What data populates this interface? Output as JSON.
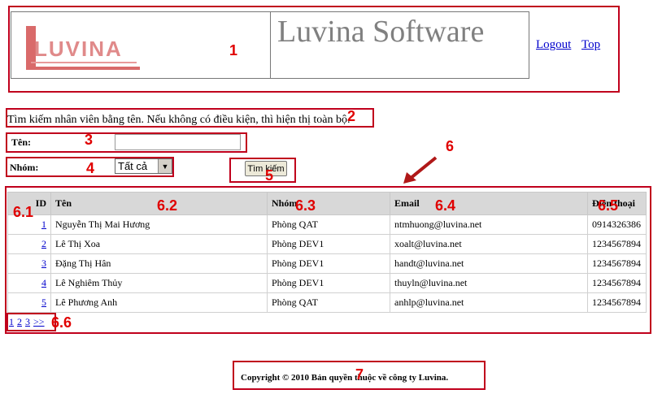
{
  "header": {
    "logo_text": "LUVINA",
    "site_title": "Luvina Software",
    "logout_label": "Logout",
    "top_label": "Top"
  },
  "search": {
    "instruction": "Tìm kiếm nhân viên bằng tên. Nếu không có điều kiện, thì hiện thị toàn bộ.",
    "name_label": "Tên:",
    "name_value": "",
    "group_label": "Nhóm:",
    "group_selected": "Tất cả",
    "search_button": "Tìm kiếm"
  },
  "table": {
    "headers": [
      "ID",
      "Tên",
      "Nhóm",
      "Email",
      "Điện thoại"
    ],
    "rows": [
      {
        "id": "1",
        "name": "Nguyễn Thị Mai Hương",
        "group": "Phòng QAT",
        "email": "ntmhuong@luvina.net",
        "phone": "0914326386"
      },
      {
        "id": "2",
        "name": "Lê Thị Xoa",
        "group": "Phòng DEV1",
        "email": "xoalt@luvina.net",
        "phone": "1234567894"
      },
      {
        "id": "3",
        "name": "Đặng Thị Hân",
        "group": "Phòng DEV1",
        "email": "handt@luvina.net",
        "phone": "1234567894"
      },
      {
        "id": "4",
        "name": "Lê Nghiêm Thủy",
        "group": "Phòng DEV1",
        "email": "thuyln@luvina.net",
        "phone": "1234567894"
      },
      {
        "id": "5",
        "name": "Lê Phương Anh",
        "group": "Phòng QAT",
        "email": "anhlp@luvina.net",
        "phone": "1234567894"
      }
    ]
  },
  "pagination": [
    "1",
    "2",
    "3",
    ">>"
  ],
  "footer": {
    "copyright": "Copyright © 2010 Bản quyền thuộc về công ty Luvina."
  },
  "annotations": {
    "a1": "1",
    "a2": "2",
    "a3": "3",
    "a4": "4",
    "a5": "5",
    "a6": "6",
    "a61": "6.1",
    "a62": "6.2",
    "a63": "6.3",
    "a64": "6.4",
    "a65": "6.5",
    "a66": "6.6",
    "a7": "7"
  },
  "colors": {
    "annotation_red": "#c0001c",
    "annotation_text": "#e00000",
    "link_blue": "#0000cc",
    "header_gray": "#d8d8d8",
    "logo_pink": "#e08a8a"
  }
}
